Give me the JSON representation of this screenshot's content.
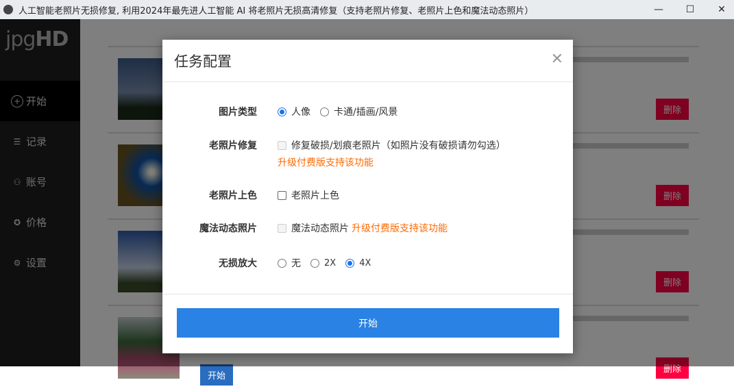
{
  "window": {
    "title": "人工智能老照片无损修复, 利用2024年最先进人工智能 AI 将老照片无损高清修复（支持老照片修复、老照片上色和魔法动态照片）",
    "minimize": "—",
    "maximize": "☐",
    "close": "✕"
  },
  "sidebar": {
    "logo_light": "jpg",
    "logo_bold": "HD",
    "items": [
      {
        "label": "开始",
        "icon": "plus-circle-icon",
        "glyph": "+"
      },
      {
        "label": "记录",
        "icon": "list-icon",
        "glyph": "☰"
      },
      {
        "label": "账号",
        "icon": "user-icon",
        "glyph": "⚇"
      },
      {
        "label": "价格",
        "icon": "award-icon",
        "glyph": "✪"
      },
      {
        "label": "设置",
        "icon": "gear-icon",
        "glyph": "⚙"
      }
    ]
  },
  "list": {
    "delete_label": "删除",
    "start_label": "开始"
  },
  "modal": {
    "title": "任务配置",
    "close": "✕",
    "image_type": {
      "label": "图片类型",
      "options": [
        "人像",
        "卡通/插画/风景"
      ],
      "selected": "人像"
    },
    "repair": {
      "label": "老照片修复",
      "option": "修复破损/划痕老照片（如照片没有破损请勿勾选）",
      "note": "升级付费版支持该功能"
    },
    "colorize": {
      "label": "老照片上色",
      "option": "老照片上色"
    },
    "magic": {
      "label": "魔法动态照片",
      "option": "魔法动态照片",
      "note": "升级付费版支持该功能"
    },
    "upscale": {
      "label": "无损放大",
      "options": [
        "无",
        "2X",
        "4X"
      ],
      "selected": "4X"
    },
    "start": "开始"
  },
  "colors": {
    "accent": "#2a82e4",
    "delete": "#ff0040",
    "upgrade": "#ff6a00"
  }
}
